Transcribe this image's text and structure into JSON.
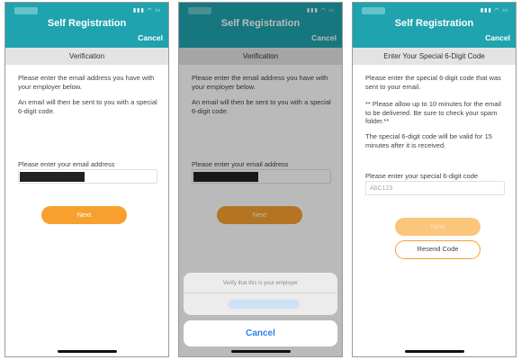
{
  "status_icons": "▮▮▮ ◠ ▭",
  "screens": [
    {
      "title": "Self Registration",
      "cancel": "Cancel",
      "section": "Verification",
      "paragraph1": "Please enter the email address you have with your employer below.",
      "paragraph2": "An email will then be sent to you with a special 6-digit code.",
      "field_label": "Please enter your email address",
      "next": "Next"
    },
    {
      "title": "Self Registration",
      "cancel": "Cancel",
      "section": "Verification",
      "paragraph1": "Please enter the email address you have with your employer below.",
      "paragraph2": "An email will then be sent to you with a special 6-digit code.",
      "field_label": "Please enter your email address",
      "next": "Next",
      "sheet_title": "Verify that this is your employer",
      "sheet_cancel": "Cancel"
    },
    {
      "title": "Self Registration",
      "cancel": "Cancel",
      "section": "Enter Your Special 6-Digit Code",
      "paragraph1": "Please enter the special 6-digit code that was sent to your email.",
      "paragraph2": "** Please allow up to 10 minutes for the email to be delivered. Be sure to check your spam folder.**",
      "paragraph3": "The special 6-digit code will be valid for 15 minutes after it is received.",
      "field_label": "Please enter your special 6-digit code",
      "code_placeholder": "AbC123",
      "next": "Next",
      "resend": "Resend Code"
    }
  ],
  "colors": {
    "header": "#1fa3ae",
    "button": "#f7a02e",
    "sheet_cancel_text": "#2f7fe6"
  }
}
